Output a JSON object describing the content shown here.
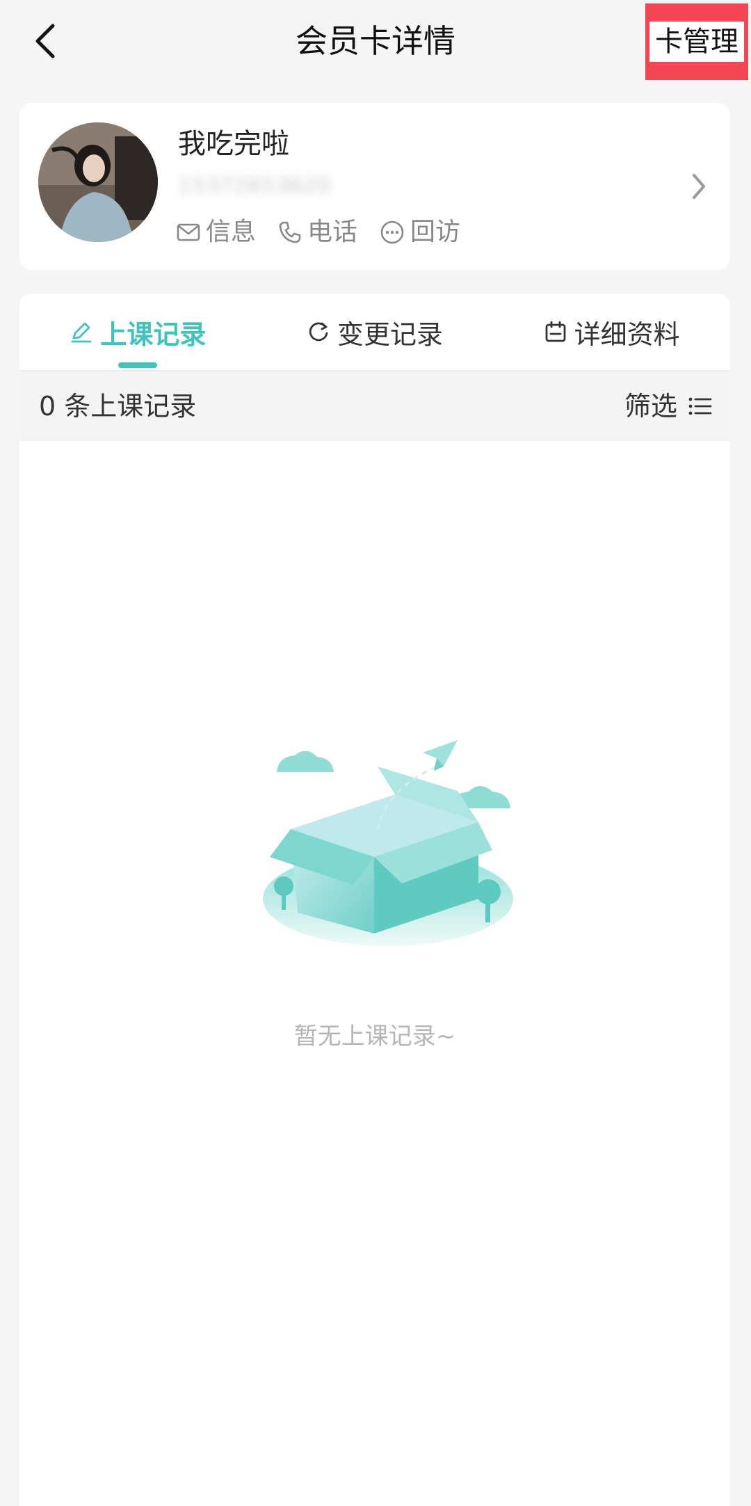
{
  "header": {
    "title": "会员卡详情",
    "manage_label": "卡管理"
  },
  "profile": {
    "name": "我吃完啦",
    "phone": "15372653620",
    "actions": [
      {
        "label": "信息",
        "icon": "mail-icon"
      },
      {
        "label": "电话",
        "icon": "phone-icon"
      },
      {
        "label": "回访",
        "icon": "chat-dots-icon"
      }
    ]
  },
  "tabs": [
    {
      "label": "上课记录",
      "icon": "pencil-icon",
      "active": true
    },
    {
      "label": "变更记录",
      "icon": "refresh-icon",
      "active": false
    },
    {
      "label": "详细资料",
      "icon": "calendar-icon",
      "active": false
    }
  ],
  "records": {
    "count_text": "0 条上课记录",
    "filter_label": "筛选"
  },
  "empty": {
    "text": "暂无上课记录~"
  },
  "colors": {
    "accent": "#3fc3ba",
    "highlight": "#f34553"
  }
}
